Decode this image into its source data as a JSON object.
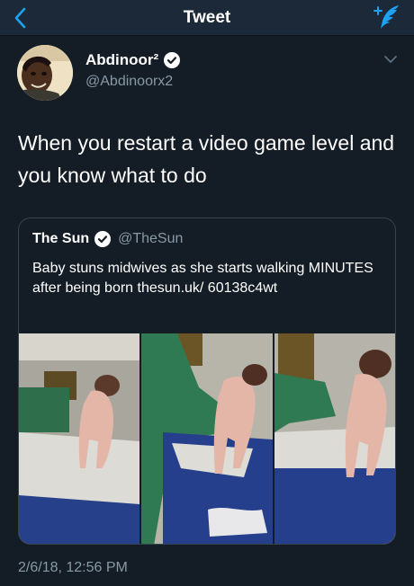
{
  "navbar": {
    "title": "Tweet",
    "back_icon": "chevron-left-icon",
    "compose_icon": "compose-feather-icon"
  },
  "tweet": {
    "author_name": "Abdinoor²",
    "author_handle": "@Abdinoorx2",
    "verified": true,
    "text": "When you restart a video game level and you know what to do",
    "timestamp": "2/6/18, 12:56 PM"
  },
  "quoted_tweet": {
    "author_name": "The Sun",
    "author_handle": "@TheSun",
    "verified": true,
    "text": "Baby stuns midwives as she starts walking MINUTES after being born thesun.uk/ 60138c4wt"
  },
  "colors": {
    "background": "#141d26",
    "navbar": "#1c2938",
    "accent": "#1da1f2",
    "secondary_text": "#8899a6"
  }
}
